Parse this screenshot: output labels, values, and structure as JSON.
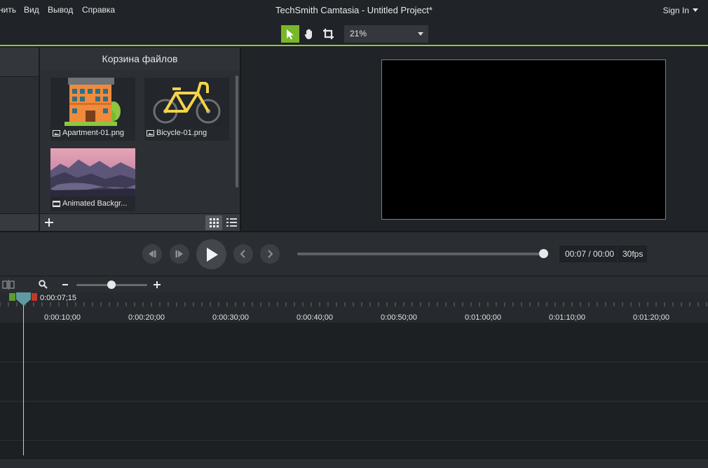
{
  "menu": {
    "items": [
      "нить",
      "Вид",
      "Вывод",
      "Справка"
    ],
    "app_title": "TechSmith Camtasia - Untitled Project*",
    "signin_label": "Sign In"
  },
  "toolbar": {
    "zoom_value": "21%",
    "tools": [
      "select-tool",
      "pan-tool",
      "crop-tool"
    ],
    "active_tool": "select-tool",
    "accent_color": "#78b72a"
  },
  "media_bin": {
    "title": "Корзина файлов",
    "items": [
      {
        "label": "Apartment-01.png",
        "type": "image"
      },
      {
        "label": "Bicycle-01.png",
        "type": "image"
      },
      {
        "label": "Animated Backgr...",
        "type": "video"
      }
    ]
  },
  "playback": {
    "time": "00:07 / 00:00",
    "fps": "30fps",
    "progress": 1.0
  },
  "timeline": {
    "playhead_time": "0:00:07;15",
    "zoom_level": 0.5,
    "ruler_labels": [
      "0:00:10;00",
      "0:00:20;00",
      "0:00:30;00",
      "0:00:40;00",
      "0:00:50;00",
      "0:01:00;00",
      "0:01:10;00",
      "0:01:20;00"
    ]
  }
}
